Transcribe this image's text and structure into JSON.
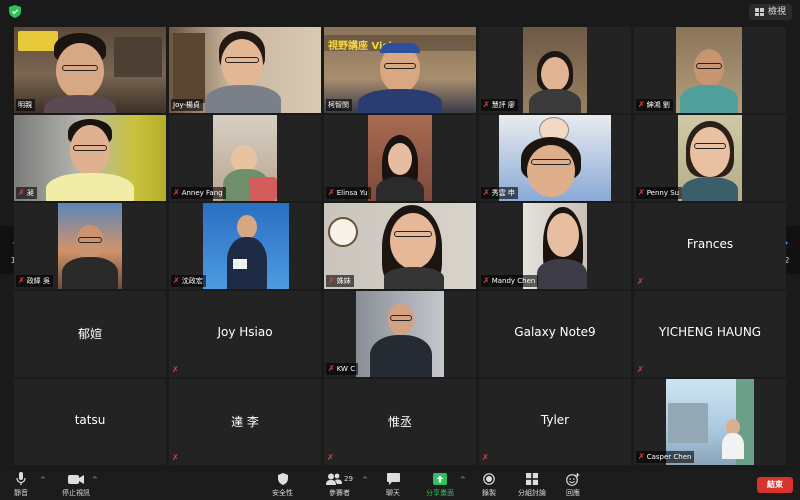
{
  "topbar": {
    "view_label": "檢視"
  },
  "pagination": {
    "left": "1/2",
    "right": "1/2"
  },
  "participants": [
    {
      "name": "明親"
    },
    {
      "name": "Joy-楊貞"
    },
    {
      "name": "柯智閔",
      "banner": "視野講座 Vision"
    },
    {
      "name": "慧評 廖"
    },
    {
      "name": "紳鴻 劉"
    },
    {
      "name": "昶"
    },
    {
      "name": "Anney Fang"
    },
    {
      "name": "Elinsa Yu"
    },
    {
      "name": "秀雲 申"
    },
    {
      "name": "Penny Su"
    },
    {
      "name": "政緯 吳"
    },
    {
      "name": "沈政宏"
    },
    {
      "name": "姝妹"
    },
    {
      "name": "Mandy Chen"
    },
    {
      "name": "Frances"
    },
    {
      "name": "郁媗"
    },
    {
      "name": "Joy Hsiao"
    },
    {
      "name": "KW C"
    },
    {
      "name": "Galaxy Note9"
    },
    {
      "name": "YICHENG HAUNG"
    },
    {
      "name": "tatsu"
    },
    {
      "name": "達 李"
    },
    {
      "name": "惟丞"
    },
    {
      "name": "Tyler"
    },
    {
      "name": "Casper Chen"
    }
  ],
  "toolbar": {
    "mute": "靜音",
    "stop_video": "停止視訊",
    "security": "安全性",
    "participants": "參賽者",
    "participants_count": "29",
    "chat": "聊天",
    "share_screen": "分享畫面",
    "record": "錄製",
    "breakout": "分組討論",
    "reactions": "回應",
    "end": "結束"
  },
  "colors": {
    "active_border": "#c9d75e",
    "share_green": "#2ec05b",
    "end_red": "#d7322b",
    "mute_red": "#e0463a"
  }
}
